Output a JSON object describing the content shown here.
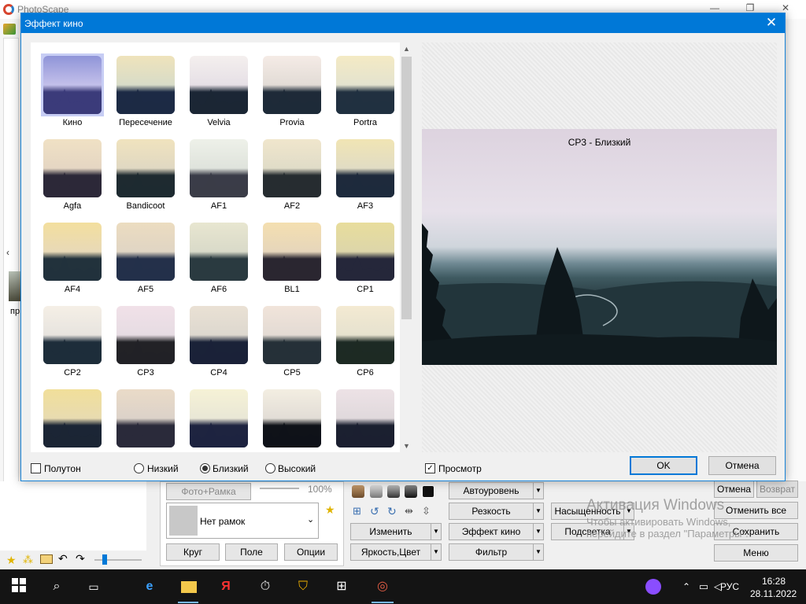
{
  "app": {
    "title": "PhotoScape"
  },
  "dialog": {
    "title": "Эффект кино",
    "close_glyph": "✕",
    "effects": [
      {
        "label": "Кино",
        "selected": true,
        "sky": [
          "#8f94d8",
          "#c3c0ea"
        ],
        "land": "#3b3b7a"
      },
      {
        "label": "Пересечение",
        "sky": [
          "#efe3bb",
          "#d8dcc8"
        ],
        "land": "#1c2a45"
      },
      {
        "label": "Velvia",
        "sky": [
          "#f4efee",
          "#e6e0e6"
        ],
        "land": "#1b2635"
      },
      {
        "label": "Provia",
        "sky": [
          "#f5ebe6",
          "#e2dcd6"
        ],
        "land": "#1e2a38"
      },
      {
        "label": "Portra",
        "sky": [
          "#f4eac4",
          "#e4e3cf"
        ],
        "land": "#213040"
      },
      {
        "label": "Agfa",
        "sky": [
          "#f0e1c4",
          "#e5d6c3"
        ],
        "land": "#2c2838"
      },
      {
        "label": "Bandicoot",
        "sky": [
          "#f0e3be",
          "#e0d8c2"
        ],
        "land": "#1e2a30"
      },
      {
        "label": "AF1",
        "sky": [
          "#eef1e9",
          "#dfe3dc"
        ],
        "land": "#3a3c48"
      },
      {
        "label": "AF2",
        "sky": [
          "#f0e6cc",
          "#e0dcc8"
        ],
        "land": "#262c30"
      },
      {
        "label": "AF3",
        "sky": [
          "#f1e5b4",
          "#e1dcc4"
        ],
        "land": "#1e2a3c"
      },
      {
        "label": "AF4",
        "sky": [
          "#f3df9e",
          "#e8d9b7"
        ],
        "land": "#22323c"
      },
      {
        "label": "AF5",
        "sky": [
          "#ecdcc0",
          "#e0d5c4"
        ],
        "land": "#24304a"
      },
      {
        "label": "AF6",
        "sky": [
          "#e8e6d0",
          "#d9dac9"
        ],
        "land": "#2a3a40"
      },
      {
        "label": "BL1",
        "sky": [
          "#f4dfb0",
          "#e6d6bb"
        ],
        "land": "#2a2630"
      },
      {
        "label": "CP1",
        "sky": [
          "#e8dd9c",
          "#ddd6aa"
        ],
        "land": "#25273a"
      },
      {
        "label": "CP2",
        "sky": [
          "#f5efe6",
          "#e7e4df"
        ],
        "land": "#1d2d3a"
      },
      {
        "label": "CP3",
        "sky": [
          "#f1e1e8",
          "#e6dce3"
        ],
        "land": "#222226"
      },
      {
        "label": "CP4",
        "sky": [
          "#eae1d4",
          "#ddd8cf"
        ],
        "land": "#1a2238"
      },
      {
        "label": "CP5",
        "sky": [
          "#f1e4da",
          "#e3dbd4"
        ],
        "land": "#253038"
      },
      {
        "label": "CP6",
        "sky": [
          "#f4ead2",
          "#e6e2cf"
        ],
        "land": "#1d2a24"
      },
      {
        "label": "",
        "sky": [
          "#f1df9a",
          "#e8dbb0"
        ],
        "land": "#1b2535"
      },
      {
        "label": "",
        "sky": [
          "#eadbc8",
          "#dcd2c9"
        ],
        "land": "#2a2a3a"
      },
      {
        "label": "",
        "sky": [
          "#f6f2d6",
          "#e9e7d6"
        ],
        "land": "#1e2440"
      },
      {
        "label": "",
        "sky": [
          "#f3eee2",
          "#e2ddd6"
        ],
        "land": "#0f1218"
      },
      {
        "label": "",
        "sky": [
          "#ede2e6",
          "#e0d9dc"
        ],
        "land": "#1b2030"
      }
    ],
    "preview_caption": "CP3 - Близкий",
    "options": {
      "halftone": "Полутон",
      "low": "Низкий",
      "close": "Близкий",
      "high": "Высокий",
      "preview": "Просмотр"
    },
    "ok": "OK",
    "cancel": "Отмена"
  },
  "bottom": {
    "photo_frame": "Фото+Рамка",
    "zoom": "100%",
    "frame_select": "Нет рамок",
    "circle": "Круг",
    "field": "Поле",
    "options": "Опции",
    "change": "Изменить",
    "brightness_color": "Яркость,Цвет",
    "auto_level": "Автоуровень",
    "sharpness": "Резкость",
    "film_effect": "Эффект кино",
    "filter": "Фильтр",
    "saturation": "Насыщенность",
    "backlight": "Подсветка",
    "cancel": "Отмена",
    "return": "Возврат",
    "cancel_all": "Отменить все",
    "save": "Сохранить",
    "menu": "Меню",
    "left_thumb_label": "пр"
  },
  "watermark": {
    "line1": "Активация Windows",
    "line2": "Чтобы активировать Windows,",
    "line3": "перейдите в раздел \"Параметры\"."
  },
  "taskbar": {
    "lang": "РУС",
    "time": "16:28",
    "date": "28.11.2022"
  }
}
